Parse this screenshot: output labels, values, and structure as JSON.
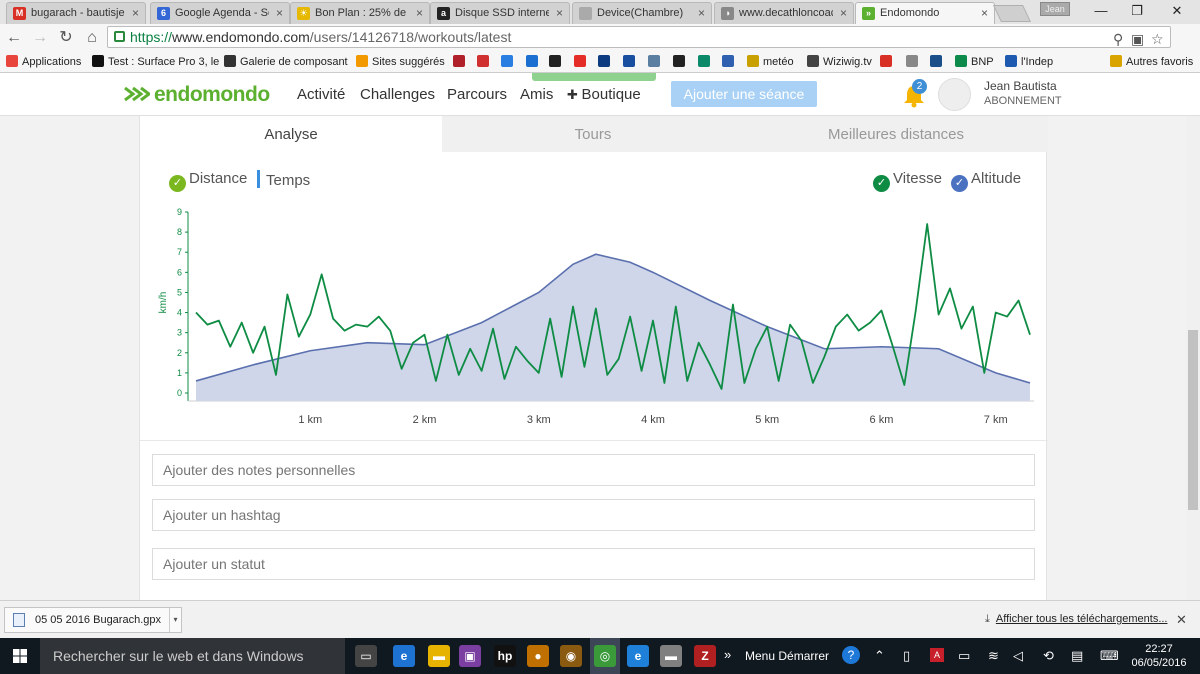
{
  "browser": {
    "tabs": [
      {
        "title": "bugarach - bautisje",
        "icon": "gmail-icon",
        "color": "#d93025",
        "glyph": "M"
      },
      {
        "title": "Google Agenda - Se",
        "icon": "calendar-icon",
        "color": "#3367d6",
        "glyph": "6"
      },
      {
        "title": "Bon Plan : 25% de",
        "icon": "bonplan-icon",
        "color": "#e6b800",
        "glyph": "☀"
      },
      {
        "title": "Disque SSD interne",
        "icon": "amazon-icon",
        "color": "#222222",
        "glyph": "a"
      },
      {
        "title": "Device(Chambre)",
        "icon": "page-icon",
        "color": "#aaaaaa",
        "glyph": ""
      },
      {
        "title": "www.decathloncoach",
        "icon": "decathlon-icon",
        "color": "#888888",
        "glyph": "◑"
      },
      {
        "title": "Endomondo",
        "icon": "endomondo-icon",
        "color": "#5cb030",
        "glyph": "»"
      }
    ],
    "user_badge": "Jean",
    "window": {
      "minimize": "—",
      "restore": "❐",
      "close": "✕"
    },
    "url": {
      "protocol": "https://",
      "host": "www.endomondo.com",
      "path": "/users/14126718/workouts/latest"
    },
    "bookmarks": [
      {
        "label": "Applications",
        "icon": "apps-icon",
        "color": "#e8453c"
      },
      {
        "label": "Test : Surface Pro 3, le",
        "icon": "site-icon",
        "color": "#111111"
      },
      {
        "label": "Galerie de composant",
        "icon": "gallery-icon",
        "color": "#333333"
      },
      {
        "label": "Sites suggérés",
        "icon": "suggested-icon",
        "color": "#f29900"
      },
      {
        "label": "",
        "icon": "hc-icon",
        "color": "#b0202a"
      },
      {
        "label": "",
        "icon": "stripes-icon",
        "color": "#d03030"
      },
      {
        "label": "",
        "icon": "dropbox-icon",
        "color": "#2a7de1"
      },
      {
        "label": "",
        "icon": "dx-icon",
        "color": "#1a6fd0"
      },
      {
        "label": "",
        "icon": "amazon-icon",
        "color": "#222222"
      },
      {
        "label": "",
        "icon": "youtube-icon",
        "color": "#e52d27"
      },
      {
        "label": "",
        "icon": "booking-icon",
        "color": "#0c3b82"
      },
      {
        "label": "",
        "icon": "td-icon",
        "color": "#1a4fa0"
      },
      {
        "label": "",
        "icon": "bird-icon",
        "color": "#5a7fa0"
      },
      {
        "label": "",
        "icon": "shield-icon",
        "color": "#222222"
      },
      {
        "label": "",
        "icon": "ca-icon",
        "color": "#0b8a6a"
      },
      {
        "label": "",
        "icon": "briefcase-icon",
        "color": "#3060b0"
      },
      {
        "label": "metéo",
        "icon": "mc-icon",
        "color": "#c8a000"
      },
      {
        "label": "Wiziwig.tv",
        "icon": "wiziwig-icon",
        "color": "#444444"
      },
      {
        "label": "",
        "icon": "gmail-icon",
        "color": "#d93025"
      },
      {
        "label": "",
        "icon": "doc-icon",
        "color": "#888888"
      },
      {
        "label": "",
        "icon": "t-icon",
        "color": "#1a4f8a"
      },
      {
        "label": "BNP",
        "icon": "bnp-icon",
        "color": "#0b8a4a"
      },
      {
        "label": "l'Indep",
        "icon": "indep-icon",
        "color": "#1e5ab0"
      },
      {
        "label": "Autres favoris",
        "icon": "folder-icon",
        "color": "#d9a400"
      }
    ]
  },
  "site": {
    "logo": "endomondo",
    "nav": [
      "Activité",
      "Challenges",
      "Parcours",
      "Amis",
      "Boutique"
    ],
    "add_button": "Ajouter une séance",
    "notifications": "2",
    "user_name": "Jean Bautista",
    "user_status": "ABONNEMENT"
  },
  "workout": {
    "tabs": [
      "Analyse",
      "Tours",
      "Meilleures distances"
    ],
    "legend_left": [
      "Distance",
      "Temps"
    ],
    "legend_right": [
      "Vitesse",
      "Altitude"
    ],
    "notes_placeholder": "Ajouter des notes personnelles",
    "hashtag_placeholder": "Ajouter un hashtag",
    "status_placeholder": "Ajouter un statut"
  },
  "chart_data": {
    "type": "line",
    "xlabel": "",
    "ylabel": "km/h",
    "x_range": [
      0,
      7.3
    ],
    "ylim": [
      0,
      9
    ],
    "x_ticks": [
      "1 km",
      "2 km",
      "3 km",
      "4 km",
      "5 km",
      "6 km",
      "7 km"
    ],
    "x_tick_values": [
      1,
      2,
      3,
      4,
      5,
      6,
      7
    ],
    "y_ticks": [
      "0",
      "1",
      "2",
      "3",
      "4",
      "5",
      "6",
      "7",
      "8",
      "9"
    ],
    "series": [
      {
        "name": "Altitude",
        "kind": "area",
        "color": "#5a6fae",
        "fill": "#cfd6ea",
        "x": [
          0,
          0.5,
          1,
          1.5,
          2,
          2.5,
          3,
          3.3,
          3.5,
          3.8,
          4,
          4.5,
          5,
          5.5,
          6,
          6.5,
          7,
          7.3
        ],
        "values": [
          0.6,
          1.4,
          2.1,
          2.5,
          2.4,
          3.5,
          5.0,
          6.4,
          6.9,
          6.5,
          6.0,
          4.6,
          3.3,
          2.2,
          2.3,
          2.2,
          1.0,
          0.5
        ]
      },
      {
        "name": "Vitesse",
        "kind": "line",
        "color": "#0e8c44",
        "x": [
          0,
          0.1,
          0.2,
          0.3,
          0.4,
          0.5,
          0.6,
          0.7,
          0.8,
          0.9,
          1.0,
          1.1,
          1.2,
          1.3,
          1.4,
          1.5,
          1.6,
          1.7,
          1.8,
          1.9,
          2.0,
          2.1,
          2.2,
          2.3,
          2.4,
          2.5,
          2.6,
          2.7,
          2.8,
          2.9,
          3.0,
          3.1,
          3.2,
          3.3,
          3.4,
          3.5,
          3.6,
          3.7,
          3.8,
          3.9,
          4.0,
          4.1,
          4.2,
          4.3,
          4.4,
          4.5,
          4.6,
          4.7,
          4.8,
          4.9,
          5.0,
          5.1,
          5.2,
          5.3,
          5.4,
          5.5,
          5.6,
          5.7,
          5.8,
          5.9,
          6.0,
          6.1,
          6.2,
          6.3,
          6.4,
          6.5,
          6.6,
          6.7,
          6.8,
          6.9,
          7.0,
          7.1,
          7.2,
          7.3
        ],
        "values": [
          4.0,
          3.4,
          3.6,
          2.3,
          3.5,
          2.0,
          3.3,
          0.9,
          4.9,
          2.8,
          3.9,
          5.9,
          3.7,
          3.1,
          3.4,
          3.3,
          3.8,
          3.1,
          1.2,
          2.5,
          2.9,
          0.6,
          2.9,
          0.9,
          2.2,
          1.1,
          3.2,
          0.7,
          2.3,
          1.6,
          1.0,
          3.7,
          0.8,
          4.3,
          1.3,
          4.2,
          0.9,
          1.7,
          3.8,
          1.1,
          3.6,
          0.5,
          4.3,
          0.6,
          2.5,
          1.4,
          0.2,
          4.4,
          0.5,
          2.2,
          3.3,
          0.6,
          3.4,
          2.6,
          0.5,
          1.8,
          3.3,
          3.9,
          3.1,
          3.5,
          4.1,
          2.3,
          0.4,
          4.1,
          8.4,
          3.9,
          5.2,
          3.2,
          4.3,
          1.0,
          4.0,
          3.8,
          4.6,
          2.9
        ]
      }
    ]
  },
  "downloads": {
    "file": "05 05 2016 Bugarach.gpx",
    "show_all": "Afficher tous les téléchargements..."
  },
  "taskbar": {
    "search_placeholder": "Rechercher sur le web et dans Windows",
    "menu_label": "Menu Démarrer",
    "time": "22:27",
    "date": "06/05/2016",
    "apps": [
      {
        "name": "task-view-icon",
        "color": "#444444",
        "glyph": "▭"
      },
      {
        "name": "edge-icon",
        "color": "#1e73d2",
        "glyph": "e"
      },
      {
        "name": "explorer-icon",
        "color": "#e6b400",
        "glyph": "▬"
      },
      {
        "name": "app-icon",
        "color": "#7a3fa0",
        "glyph": "▣"
      },
      {
        "name": "hp-icon",
        "color": "#111111",
        "glyph": "hp"
      },
      {
        "name": "media-icon",
        "color": "#c07000",
        "glyph": "●"
      },
      {
        "name": "media2-icon",
        "color": "#8a5a10",
        "glyph": "◉"
      },
      {
        "name": "chrome-icon",
        "color": "#3a9a3a",
        "glyph": "◎"
      },
      {
        "name": "ie-icon",
        "color": "#1e80d8",
        "glyph": "e"
      },
      {
        "name": "drive-icon",
        "color": "#808080",
        "glyph": "▬"
      },
      {
        "name": "filezilla-icon",
        "color": "#b02020",
        "glyph": "Z"
      }
    ]
  }
}
